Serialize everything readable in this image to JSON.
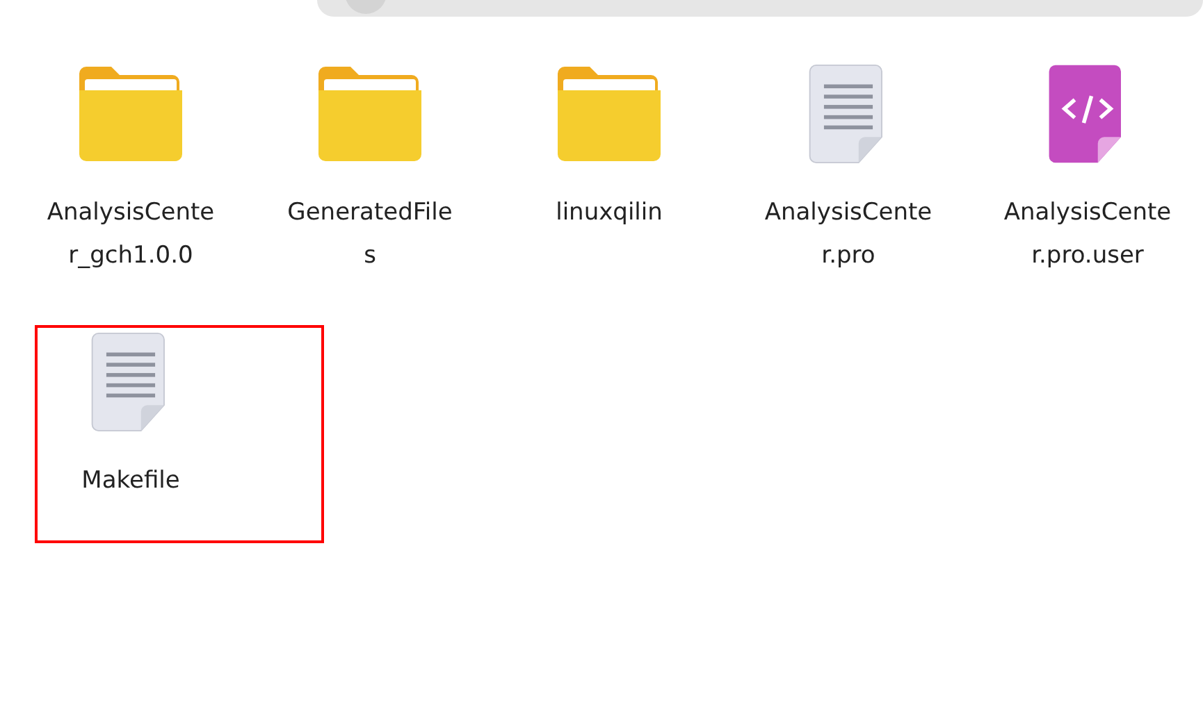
{
  "files": [
    {
      "kind": "folder",
      "name_lines": [
        "AnalysisCente",
        "r_gch1.0.0"
      ],
      "highlighted": false
    },
    {
      "kind": "folder",
      "name_lines": [
        "GeneratedFile",
        "s"
      ],
      "highlighted": false
    },
    {
      "kind": "folder",
      "name_lines": [
        "linuxqilin"
      ],
      "highlighted": false
    },
    {
      "kind": "text",
      "name_lines": [
        "AnalysisCente",
        "r.pro"
      ],
      "highlighted": false
    },
    {
      "kind": "code",
      "name_lines": [
        "AnalysisCente",
        "r.pro.user"
      ],
      "highlighted": false
    },
    {
      "kind": "text",
      "name_lines": [
        "Makefile"
      ],
      "highlighted": true
    }
  ]
}
